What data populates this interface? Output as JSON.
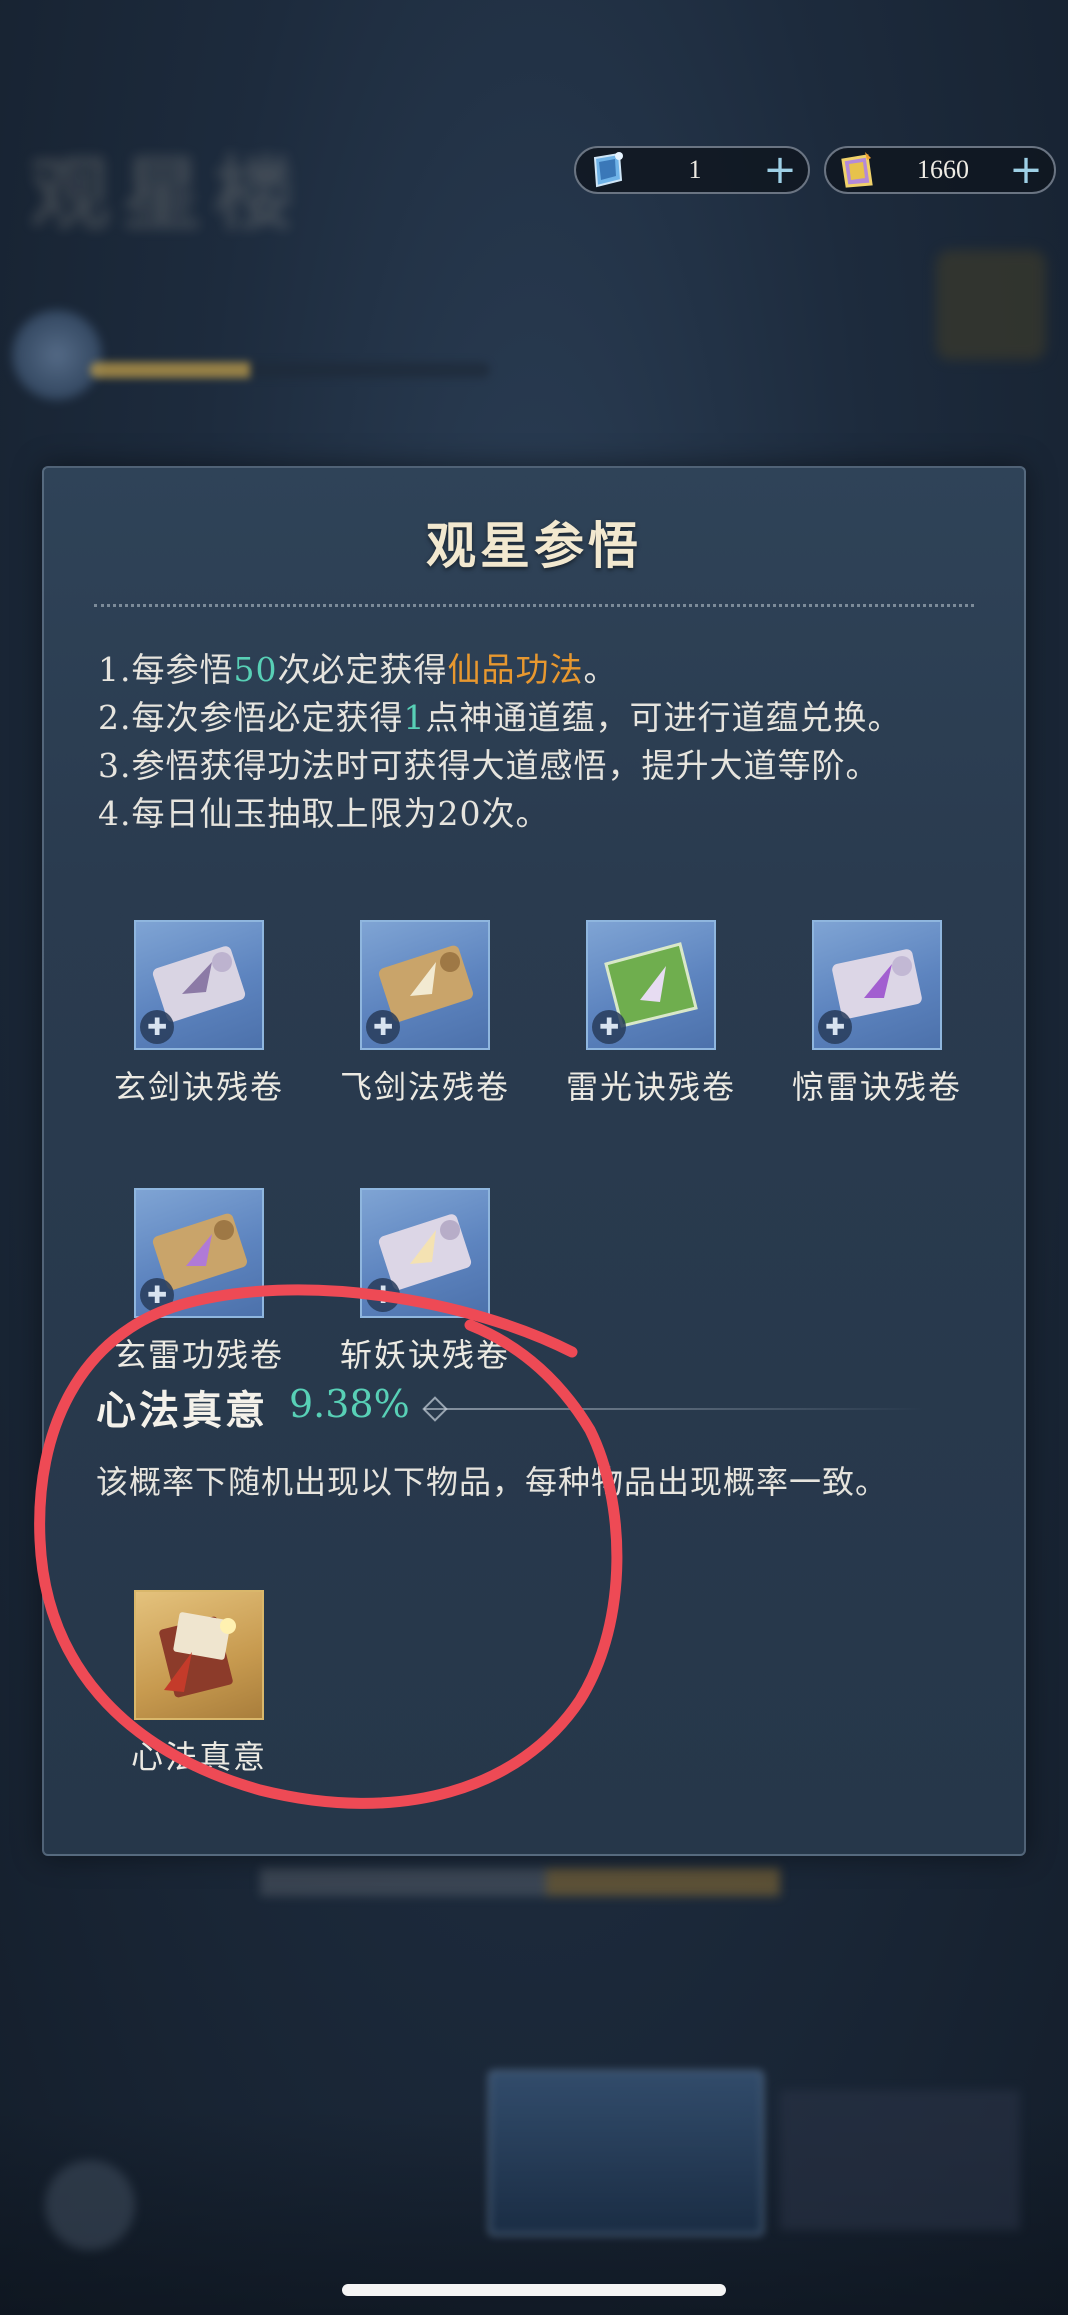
{
  "currency": {
    "ticket": {
      "icon": "ticket-icon",
      "value": "1",
      "plus": "+"
    },
    "jade": {
      "icon": "jade-icon",
      "value": "1660",
      "plus": "+"
    }
  },
  "panel": {
    "title": "观星参悟",
    "rules": [
      {
        "a": "1.每参悟",
        "b": "50",
        "c": "次必定获得",
        "d": "仙品功法",
        "e": "。"
      },
      {
        "a": "2.每次参悟必定获得",
        "b": "1",
        "c": "点神通道蕴，可进行道蕴兑换。"
      },
      {
        "a": "3.参悟获得功法时可获得大道感悟，提升大道等阶。"
      },
      {
        "a": "4.每日仙玉抽取上限为20次。"
      }
    ],
    "items": [
      {
        "label": "玄剑诀残卷",
        "icon": "scroll-icon"
      },
      {
        "label": "飞剑法残卷",
        "icon": "scroll-icon"
      },
      {
        "label": "雷光诀残卷",
        "icon": "book-icon"
      },
      {
        "label": "惊雷诀残卷",
        "icon": "scroll-icon"
      },
      {
        "label": "玄雷功残卷",
        "icon": "scroll-icon"
      },
      {
        "label": "斩妖诀残卷",
        "icon": "scroll-icon"
      }
    ],
    "section": {
      "title": "心法真意",
      "rate": "9.38%",
      "desc": "该概率下随机出现以下物品，每种物品出现概率一致。",
      "items": [
        {
          "label": "心法真意",
          "icon": "treasure-icon"
        }
      ]
    }
  },
  "colors": {
    "highlight_teal": "#58d0b6",
    "highlight_orange": "#e8982f",
    "annotation_red": "#ee4a55"
  }
}
